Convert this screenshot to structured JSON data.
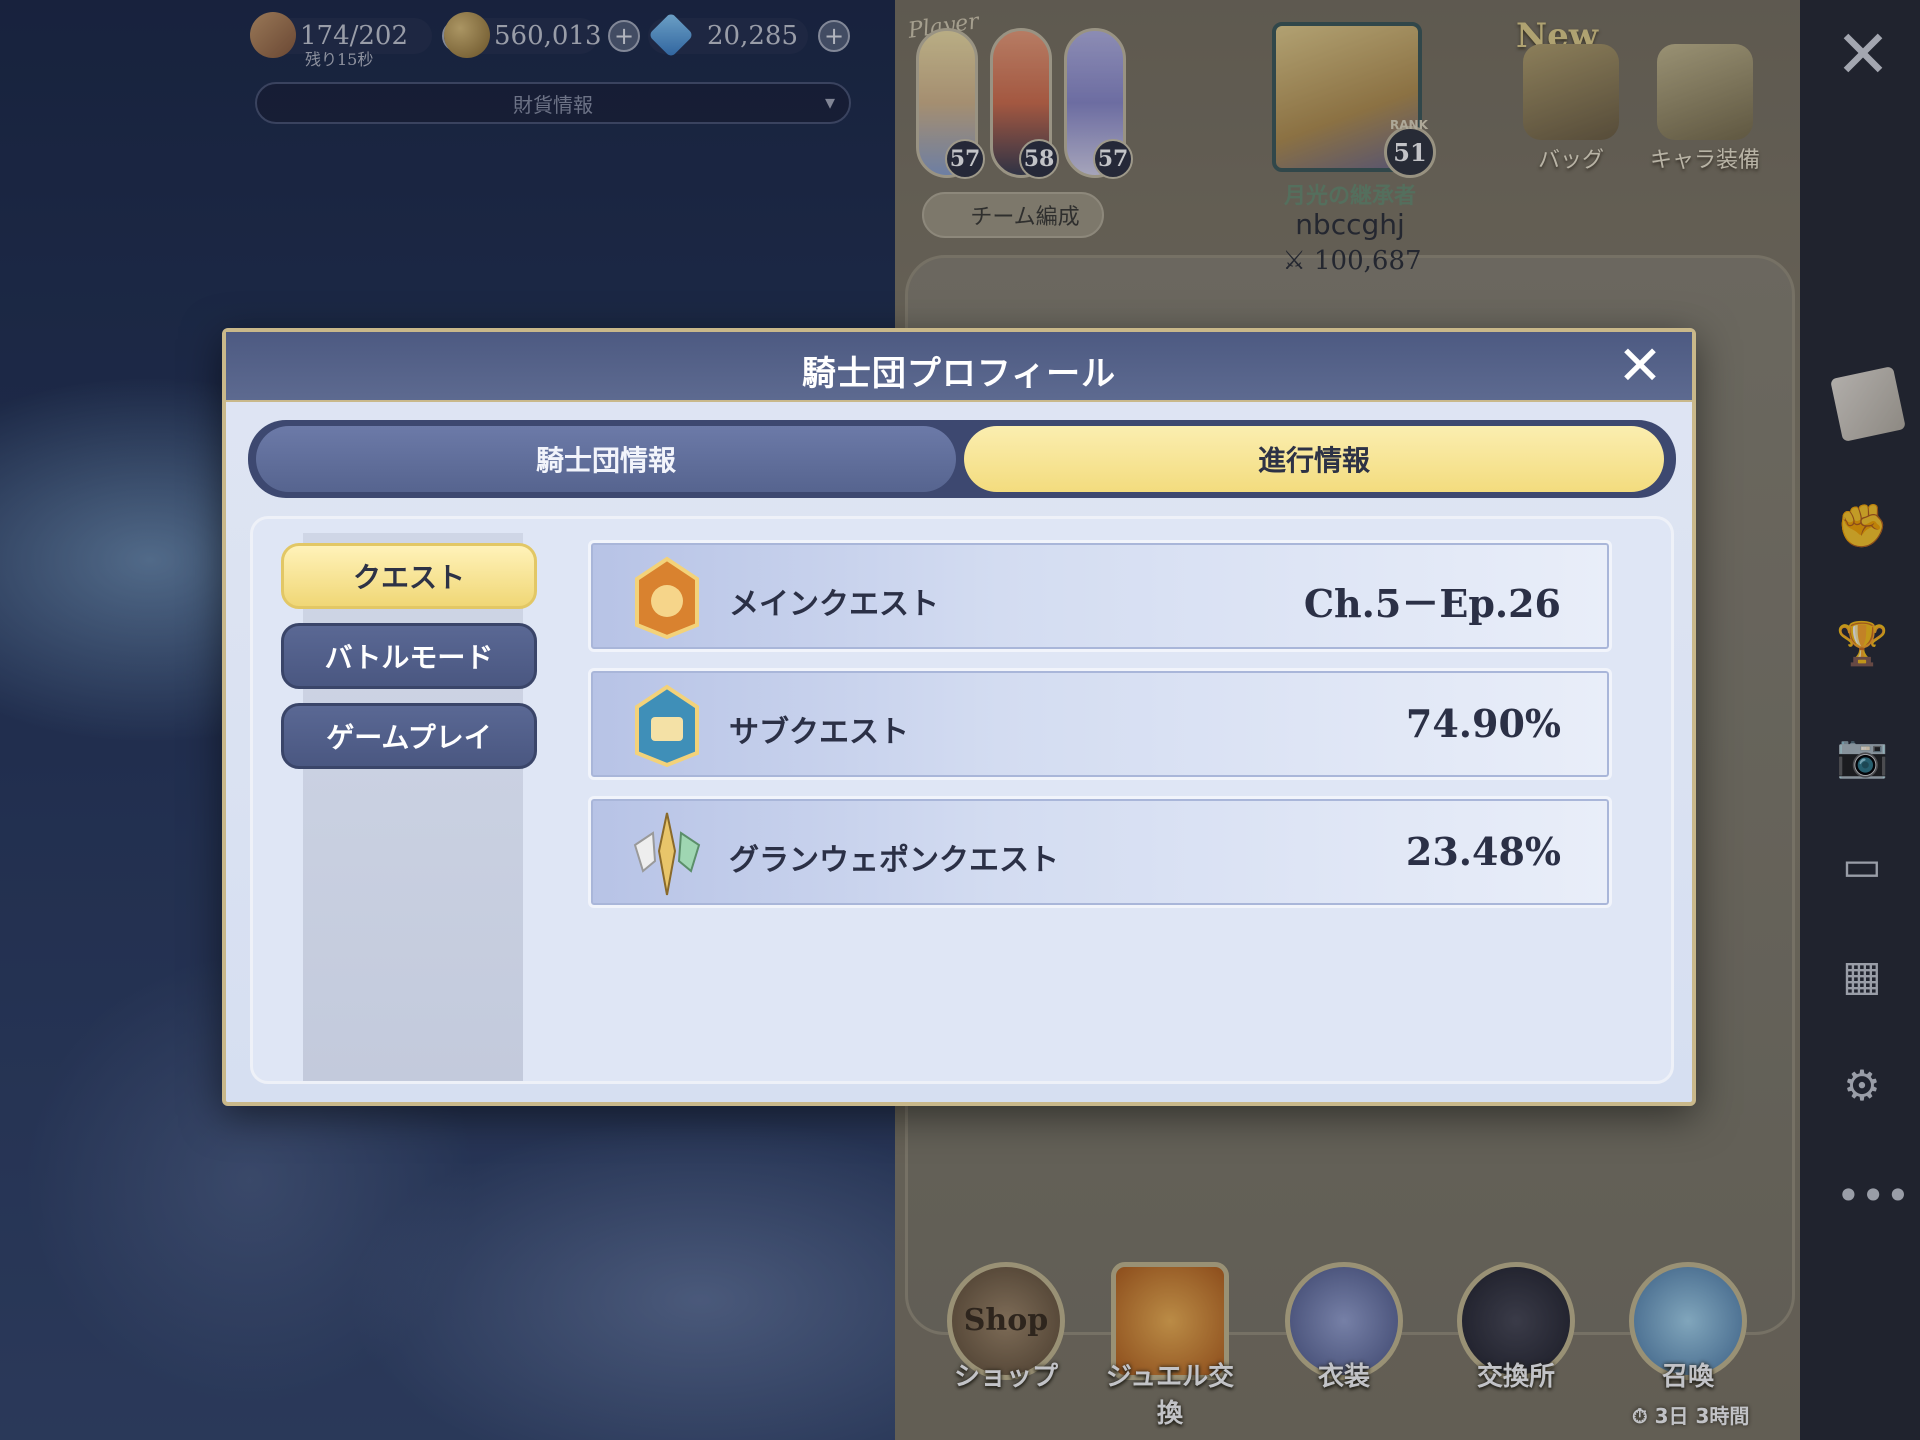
{
  "currency": {
    "stamina": "174/202",
    "stamina_timer": "残り15秒",
    "gold": "560,013",
    "gems": "20,285",
    "finance_label": "財貨情報",
    "plus": "+"
  },
  "profile": {
    "player_tag": "Player",
    "party_levels": [
      "57",
      "58",
      "57"
    ],
    "team_button": "チーム編成",
    "rank_label": "RANK",
    "rank": "51",
    "title": "月光の継承者",
    "name": "nbccghj",
    "power": "100,687",
    "new_tag": "New",
    "shortcuts": [
      "バッグ",
      "キャラ装備"
    ]
  },
  "bottom_menu": {
    "items": [
      "ショップ",
      "ジュエル交換",
      "衣装",
      "交換所",
      "召喚"
    ],
    "summon_timer": "3日 3時間",
    "shop_sign": "Shop"
  },
  "modal": {
    "title": "騎士団プロフィール",
    "tabs": [
      "騎士団情報",
      "進行情報"
    ],
    "active_tab": "進行情報",
    "categories": [
      "クエスト",
      "バトルモード",
      "ゲームプレイ"
    ],
    "active_category": "クエスト",
    "rows": [
      {
        "label": "メインクエスト",
        "value": "Ch.5－Ep.26",
        "icon": "main-quest-crest-icon"
      },
      {
        "label": "サブクエスト",
        "value": "74.90%",
        "icon": "sub-quest-crest-icon"
      },
      {
        "label": "グランウェポンクエスト",
        "value": "23.48%",
        "icon": "grand-weapon-crest-icon"
      }
    ]
  },
  "colors": {
    "header": "#4d5a82",
    "active_tab": "#f3dc7e",
    "idle_button": "#4a5781",
    "frame_gold": "#c9b88a"
  }
}
